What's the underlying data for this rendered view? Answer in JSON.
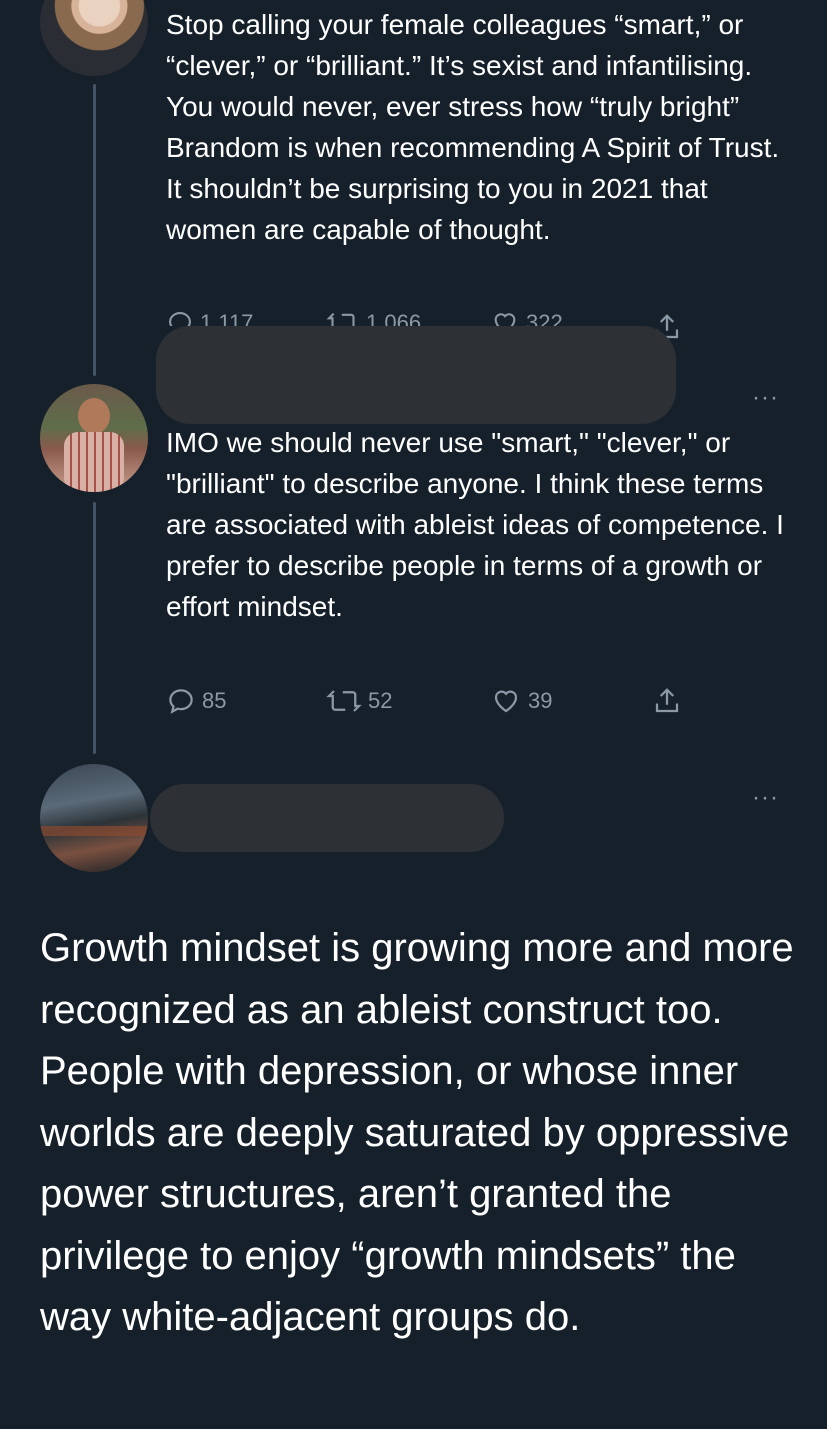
{
  "tweets": [
    {
      "text": "Stop calling your female colleagues “smart,” or “clever,” or “brilliant.” It’s sexist and infantilising. You would never, ever stress how “truly bright” Brandom is when recommending A Spirit of Trust. It shouldn’t be surprising to you in 2021 that women are capable of thought.",
      "replies": "1,117",
      "retweets": "1,066",
      "likes": "322"
    },
    {
      "text": "IMO we should never use \"smart,\" \"clever,\" or \"brilliant\" to describe anyone. I think these terms are associated with ableist ideas of competence. I prefer to describe people in terms of a growth or effort mindset.",
      "replies": "85",
      "retweets": "52",
      "likes": "39",
      "more": "···"
    },
    {
      "text": "Growth mindset is growing more and more recognized as an ableist construct too. People with depression, or whose inner worlds are deeply saturated by oppressive power structures, aren’t granted the privilege to enjoy “growth mindsets” the way white-adjacent groups do.",
      "more": "···"
    }
  ],
  "icons": {
    "reply": "reply-icon",
    "retweet": "retweet-icon",
    "like": "heart-icon",
    "share": "share-icon"
  },
  "colors": {
    "background": "#15202b",
    "text": "#ffffff",
    "muted": "#8b98a5",
    "thread_line": "#425466",
    "redaction": "#2d3135"
  }
}
